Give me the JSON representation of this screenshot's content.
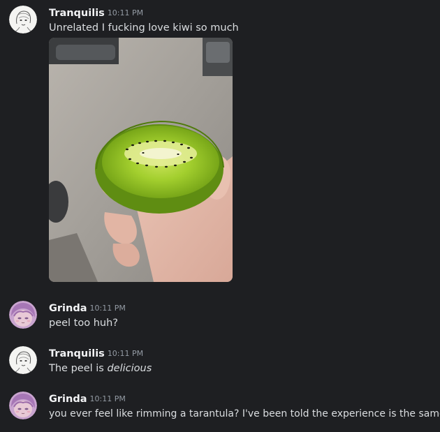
{
  "colors": {
    "background": "#1e1f22",
    "username": "#f2f3f5",
    "message_text": "#dbdee1",
    "timestamp": "#949ba4"
  },
  "messages": [
    {
      "author": "Tranquilis",
      "time": "10:11 PM",
      "avatar_icon": "sketch-portrait-avatar",
      "text": "Unrelated I fucking love kiwi so much",
      "attachment_icon": "kiwi-photo"
    },
    {
      "author": "Grinda",
      "time": "10:11 PM",
      "avatar_icon": "anime-girl-avatar",
      "text": "peel too huh?"
    },
    {
      "author": "Tranquilis",
      "time": "10:11 PM",
      "avatar_icon": "sketch-portrait-avatar",
      "text_before": "The peel is ",
      "text_emphasis": "delicious"
    },
    {
      "author": "Grinda",
      "time": "10:11 PM",
      "avatar_icon": "anime-girl-avatar",
      "text": "you ever feel like rimming a tarantula? I've been told the experience is the same"
    }
  ]
}
